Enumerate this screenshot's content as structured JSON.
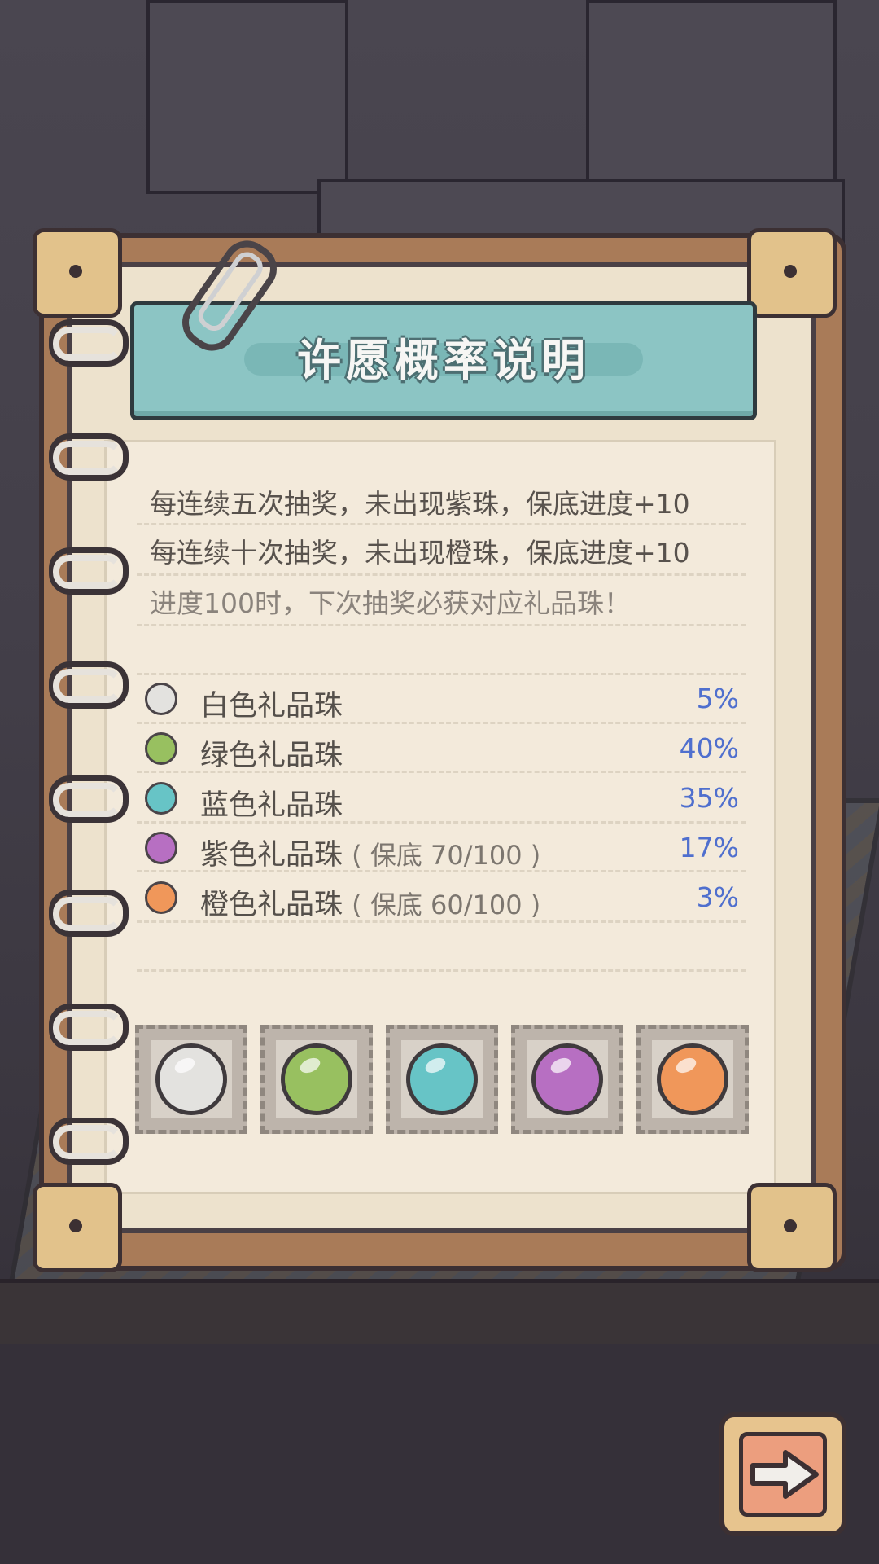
{
  "title": "许愿概率说明",
  "notes": [
    "每连续五次抽奖，未出现紫珠，保底进度+10",
    "每连续十次抽奖，未出现橙珠，保底进度+10",
    "进度100时，下次抽奖必获对应礼品珠！"
  ],
  "items": [
    {
      "name": "白色礼品珠",
      "sub": "",
      "pct": "5%",
      "color": "#e3e2df"
    },
    {
      "name": "绿色礼品珠",
      "sub": "",
      "pct": "40%",
      "color": "#98c060"
    },
    {
      "name": "蓝色礼品珠",
      "sub": "",
      "pct": "35%",
      "color": "#67c4c6"
    },
    {
      "name": "紫色礼品珠",
      "sub": "( 保底  70/100 )",
      "pct": "17%",
      "color": "#b76fc2"
    },
    {
      "name": "橙色礼品珠",
      "sub": "( 保底  60/100 )",
      "pct": "3%",
      "color": "#f0975a"
    }
  ],
  "icons": {
    "next": "arrow-right-icon",
    "clip": "paper-clip-icon"
  }
}
